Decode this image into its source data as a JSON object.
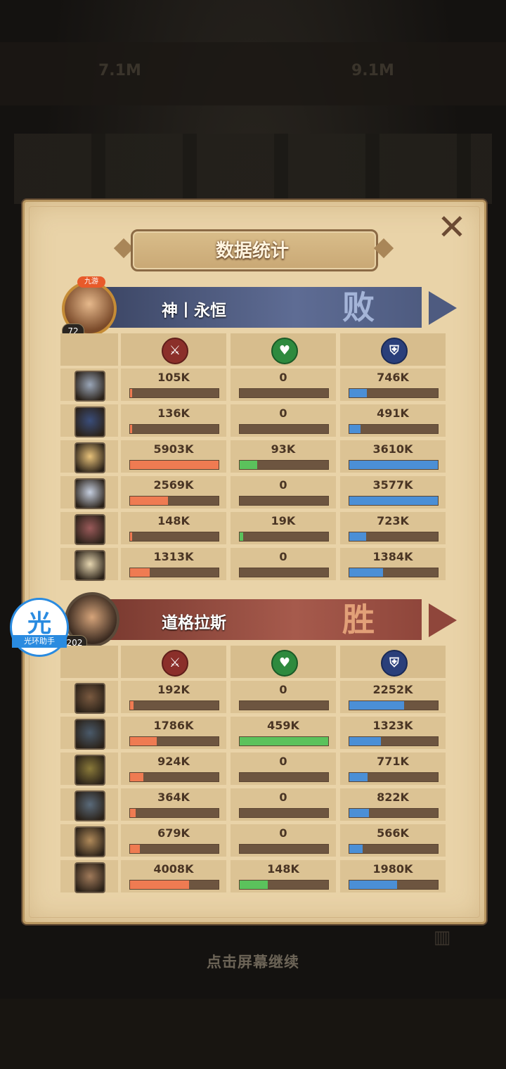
{
  "background": {
    "top_left_value": "7.1M",
    "top_right_value": "9.1M"
  },
  "panel": {
    "title": "数据统计",
    "close_icon": "close-x-icon"
  },
  "columns": [
    {
      "icon": "attack-sword-icon",
      "color": "#ef7b52"
    },
    {
      "icon": "heal-heart-icon",
      "color": "#5bc25c"
    },
    {
      "icon": "defense-shield-icon",
      "color": "#4b8fd6"
    }
  ],
  "teams": [
    {
      "name": "神丨永恒",
      "result": "败",
      "level": "72",
      "vip_label": "九游",
      "banner_color": "#55648a",
      "heroes": [
        {
          "atk": "105K",
          "heal": "0",
          "def": "746K",
          "atk_pct": 0.02,
          "heal_pct": 0,
          "def_pct": 0.2
        },
        {
          "atk": "136K",
          "heal": "0",
          "def": "491K",
          "atk_pct": 0.02,
          "heal_pct": 0,
          "def_pct": 0.13
        },
        {
          "atk": "5903K",
          "heal": "93K",
          "def": "3610K",
          "atk_pct": 1.0,
          "heal_pct": 0.2,
          "def_pct": 1.0
        },
        {
          "atk": "2569K",
          "heal": "0",
          "def": "3577K",
          "atk_pct": 0.43,
          "heal_pct": 0,
          "def_pct": 1.0
        },
        {
          "atk": "148K",
          "heal": "19K",
          "def": "723K",
          "atk_pct": 0.02,
          "heal_pct": 0.04,
          "def_pct": 0.19
        },
        {
          "atk": "1313K",
          "heal": "0",
          "def": "1384K",
          "atk_pct": 0.22,
          "heal_pct": 0,
          "def_pct": 0.38
        }
      ]
    },
    {
      "name": "道格拉斯",
      "result": "胜",
      "level": "202",
      "banner_color": "#a0544a",
      "heroes": [
        {
          "atk": "192K",
          "heal": "0",
          "def": "2252K",
          "atk_pct": 0.04,
          "heal_pct": 0,
          "def_pct": 0.62
        },
        {
          "atk": "1786K",
          "heal": "459K",
          "def": "1323K",
          "atk_pct": 0.3,
          "heal_pct": 1.0,
          "def_pct": 0.36
        },
        {
          "atk": "924K",
          "heal": "0",
          "def": "771K",
          "atk_pct": 0.15,
          "heal_pct": 0,
          "def_pct": 0.21
        },
        {
          "atk": "364K",
          "heal": "0",
          "def": "822K",
          "atk_pct": 0.06,
          "heal_pct": 0,
          "def_pct": 0.22
        },
        {
          "atk": "679K",
          "heal": "0",
          "def": "566K",
          "atk_pct": 0.11,
          "heal_pct": 0,
          "def_pct": 0.15
        },
        {
          "atk": "4008K",
          "heal": "148K",
          "def": "1980K",
          "atk_pct": 0.67,
          "heal_pct": 0.32,
          "def_pct": 0.54
        }
      ]
    }
  ],
  "footer": {
    "continue_text": "点击屏幕继续",
    "stats_icon": "statistics-chart-icon"
  },
  "assistant": {
    "char": "光",
    "label": "光环助手"
  }
}
